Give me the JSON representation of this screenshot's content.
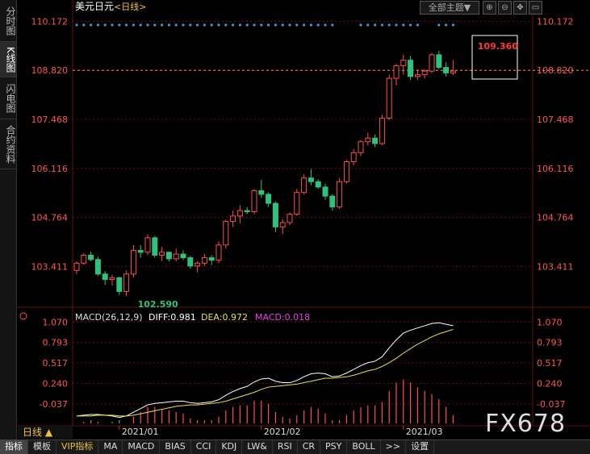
{
  "sidebar": {
    "tabs": [
      {
        "label": "分时图",
        "active": false
      },
      {
        "label": "K线图",
        "active": true
      },
      {
        "label": "闪电图",
        "active": false
      },
      {
        "label": "合约资料",
        "active": false
      }
    ]
  },
  "header": {
    "title": "美元日元",
    "period_tag": "<日线>",
    "theme_button": "全部主题▼"
  },
  "period_selector": {
    "label": "日线 ▲"
  },
  "bottom_tabs": [
    "指标",
    "模板",
    "VIP指标",
    "MA",
    "MACD",
    "BIAS",
    "CCI",
    "KDJ",
    "LW&",
    "RSI",
    "CR",
    "PSY",
    "BOLL",
    ">>",
    "设置"
  ],
  "watermark": "FX678",
  "colors": {
    "up": "#ff4d4d",
    "down": "#2ec27e",
    "dif": "#ffffff",
    "dea": "#e8e04a",
    "macd": "#e83ee8",
    "grid": "#661111",
    "price_text": "#ff5555"
  },
  "chart_data": [
    {
      "type": "candlestick",
      "title": "美元日元",
      "y_ticks": [
        "110.172",
        "108.820",
        "107.468",
        "106.116",
        "104.764",
        "103.411"
      ],
      "y_tick_values": [
        110.172,
        108.82,
        107.468,
        106.116,
        104.764,
        103.411
      ],
      "ylim": [
        102.35,
        110.45
      ],
      "x_ticks": [
        {
          "label": "2021/01",
          "index": 6
        },
        {
          "label": "2021/02",
          "index": 26
        },
        {
          "label": "2021/03",
          "index": 46
        }
      ],
      "current_price": 108.82,
      "annotations": {
        "high_label": "109.360",
        "high_value": 109.36,
        "high_index": 56,
        "low_label": "102.590",
        "low_value": 102.59,
        "low_index": 7
      },
      "ohlc": [
        [
          103.3,
          103.55,
          103.2,
          103.5
        ],
        [
          103.5,
          103.78,
          103.45,
          103.72
        ],
        [
          103.72,
          103.82,
          103.55,
          103.6
        ],
        [
          103.6,
          103.68,
          103.15,
          103.2
        ],
        [
          103.2,
          103.28,
          102.9,
          103.05
        ],
        [
          103.05,
          103.18,
          102.88,
          103.1
        ],
        [
          103.1,
          103.12,
          102.62,
          102.72
        ],
        [
          102.72,
          103.3,
          102.59,
          103.2
        ],
        [
          103.2,
          104.0,
          103.1,
          103.85
        ],
        [
          103.85,
          104.0,
          103.65,
          103.8
        ],
        [
          103.8,
          104.3,
          103.72,
          104.2
        ],
        [
          104.2,
          104.25,
          103.65,
          103.72
        ],
        [
          103.72,
          103.95,
          103.55,
          103.8
        ],
        [
          103.8,
          103.82,
          103.55,
          103.62
        ],
        [
          103.62,
          103.9,
          103.55,
          103.75
        ],
        [
          103.75,
          103.85,
          103.58,
          103.65
        ],
        [
          103.65,
          103.7,
          103.35,
          103.42
        ],
        [
          103.42,
          103.55,
          103.25,
          103.5
        ],
        [
          103.5,
          103.75,
          103.42,
          103.65
        ],
        [
          103.65,
          103.72,
          103.45,
          103.58
        ],
        [
          103.58,
          104.1,
          103.5,
          104.0
        ],
        [
          104.0,
          104.7,
          103.9,
          104.65
        ],
        [
          104.65,
          104.95,
          104.5,
          104.8
        ],
        [
          104.8,
          105.1,
          104.6,
          104.95
        ],
        [
          104.95,
          105.05,
          104.85,
          104.92
        ],
        [
          104.92,
          105.55,
          104.85,
          105.5
        ],
        [
          105.5,
          105.8,
          105.3,
          105.4
        ],
        [
          105.4,
          105.45,
          105.05,
          105.15
        ],
        [
          105.15,
          105.2,
          104.35,
          104.5
        ],
        [
          104.5,
          104.72,
          104.3,
          104.62
        ],
        [
          104.62,
          104.9,
          104.55,
          104.85
        ],
        [
          104.85,
          105.55,
          104.8,
          105.45
        ],
        [
          105.45,
          105.95,
          105.4,
          105.85
        ],
        [
          105.85,
          106.1,
          105.65,
          105.75
        ],
        [
          105.75,
          105.82,
          105.55,
          105.6
        ],
        [
          105.6,
          105.7,
          105.25,
          105.35
        ],
        [
          105.35,
          105.4,
          104.95,
          105.05
        ],
        [
          105.05,
          105.85,
          105.0,
          105.75
        ],
        [
          105.75,
          106.35,
          105.7,
          106.3
        ],
        [
          106.3,
          106.65,
          106.2,
          106.55
        ],
        [
          106.55,
          106.9,
          106.45,
          106.85
        ],
        [
          106.85,
          107.1,
          106.75,
          106.95
        ],
        [
          106.95,
          107.05,
          106.7,
          106.8
        ],
        [
          106.8,
          107.6,
          106.75,
          107.5
        ],
        [
          107.5,
          108.7,
          107.45,
          108.6
        ],
        [
          108.6,
          109.0,
          108.4,
          108.95
        ],
        [
          108.95,
          109.25,
          108.7,
          109.1
        ],
        [
          109.1,
          109.22,
          108.55,
          108.65
        ],
        [
          108.65,
          108.85,
          108.55,
          108.7
        ],
        [
          108.7,
          108.85,
          108.6,
          108.8
        ],
        [
          108.8,
          109.3,
          108.75,
          109.25
        ],
        [
          109.25,
          109.36,
          108.85,
          108.9
        ],
        [
          108.9,
          109.05,
          108.65,
          108.75
        ],
        [
          108.75,
          109.1,
          108.7,
          108.8
        ]
      ]
    },
    {
      "type": "macd",
      "params": "MACD(26,12,9)",
      "series": [
        {
          "name": "DIFF",
          "current_label": "DIFF:0.981"
        },
        {
          "name": "DEA",
          "current_label": "DEA:0.972"
        },
        {
          "name": "MACD",
          "current_label": "MACD:0.018"
        }
      ],
      "y_ticks": [
        "1.070",
        "0.793",
        "0.517",
        "0.240",
        "-0.037"
      ],
      "y_tick_values": [
        1.07,
        0.793,
        0.517,
        0.24,
        -0.037
      ],
      "ylim": [
        -0.3,
        1.15
      ],
      "diff": [
        -0.2,
        -0.19,
        -0.18,
        -0.18,
        -0.19,
        -0.2,
        -0.22,
        -0.2,
        -0.15,
        -0.1,
        -0.05,
        -0.03,
        -0.02,
        -0.01,
        0.0,
        0.0,
        -0.02,
        -0.03,
        -0.02,
        -0.01,
        0.02,
        0.08,
        0.13,
        0.17,
        0.2,
        0.26,
        0.3,
        0.31,
        0.27,
        0.25,
        0.25,
        0.28,
        0.33,
        0.37,
        0.38,
        0.37,
        0.33,
        0.34,
        0.38,
        0.43,
        0.48,
        0.52,
        0.54,
        0.6,
        0.72,
        0.83,
        0.92,
        0.96,
        0.99,
        1.02,
        1.05,
        1.06,
        1.04,
        1.02
      ],
      "dea": [
        -0.2,
        -0.2,
        -0.2,
        -0.19,
        -0.19,
        -0.19,
        -0.2,
        -0.2,
        -0.19,
        -0.17,
        -0.15,
        -0.13,
        -0.11,
        -0.09,
        -0.07,
        -0.06,
        -0.05,
        -0.05,
        -0.04,
        -0.03,
        -0.02,
        0.0,
        0.03,
        0.06,
        0.09,
        0.12,
        0.16,
        0.19,
        0.2,
        0.21,
        0.22,
        0.23,
        0.25,
        0.27,
        0.29,
        0.31,
        0.31,
        0.32,
        0.33,
        0.35,
        0.38,
        0.41,
        0.43,
        0.47,
        0.52,
        0.58,
        0.65,
        0.71,
        0.77,
        0.82,
        0.87,
        0.91,
        0.94,
        0.97
      ],
      "macd": [
        0.0,
        0.01,
        0.02,
        0.01,
        0.0,
        -0.01,
        -0.02,
        0.0,
        0.04,
        0.07,
        0.1,
        0.1,
        0.09,
        0.08,
        0.07,
        0.06,
        0.03,
        0.02,
        0.02,
        0.02,
        0.04,
        0.08,
        0.1,
        0.11,
        0.11,
        0.14,
        0.14,
        0.12,
        0.07,
        0.04,
        0.03,
        0.05,
        0.08,
        0.1,
        0.09,
        0.06,
        0.02,
        0.02,
        0.05,
        0.08,
        0.1,
        0.11,
        0.11,
        0.13,
        0.2,
        0.25,
        0.27,
        0.25,
        0.22,
        0.2,
        0.18,
        0.15,
        0.1,
        0.05
      ]
    }
  ]
}
